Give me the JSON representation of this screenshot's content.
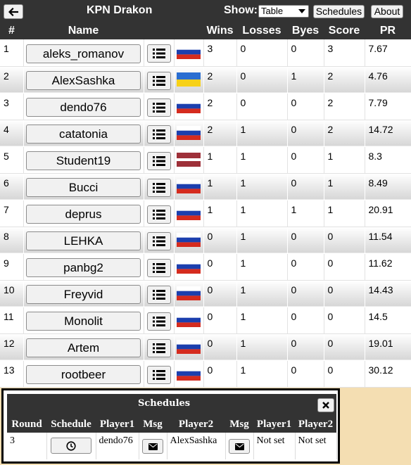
{
  "header": {
    "title": "KPN Drakon",
    "show_label": "Show:",
    "show_selected": "Table",
    "schedules_label": "Schedules",
    "about_label": "About"
  },
  "columns": {
    "rank": "#",
    "name": "Name",
    "wins": "Wins",
    "losses": "Losses",
    "byes": "Byes",
    "score": "Score",
    "pr": "PR"
  },
  "players": [
    {
      "rank": "1",
      "name": "aleks_romanov",
      "flag": "russia",
      "wins": "3",
      "losses": "0",
      "byes": "0",
      "score": "3",
      "pr": "7.67"
    },
    {
      "rank": "2",
      "name": "AlexSashka",
      "flag": "ukraine",
      "wins": "2",
      "losses": "0",
      "byes": "1",
      "score": "2",
      "pr": "4.76"
    },
    {
      "rank": "3",
      "name": "dendo76",
      "flag": "russia",
      "wins": "2",
      "losses": "0",
      "byes": "0",
      "score": "2",
      "pr": "7.79"
    },
    {
      "rank": "4",
      "name": "catatonia",
      "flag": "russia",
      "wins": "2",
      "losses": "1",
      "byes": "0",
      "score": "2",
      "pr": "14.72"
    },
    {
      "rank": "5",
      "name": "Student19",
      "flag": "latvia",
      "wins": "1",
      "losses": "1",
      "byes": "0",
      "score": "1",
      "pr": "8.3"
    },
    {
      "rank": "6",
      "name": "Bucci",
      "flag": "russia",
      "wins": "1",
      "losses": "1",
      "byes": "0",
      "score": "1",
      "pr": "8.49"
    },
    {
      "rank": "7",
      "name": "deprus",
      "flag": "russia",
      "wins": "1",
      "losses": "1",
      "byes": "1",
      "score": "1",
      "pr": "20.91"
    },
    {
      "rank": "8",
      "name": "LEHKA",
      "flag": "russia",
      "wins": "0",
      "losses": "1",
      "byes": "0",
      "score": "0",
      "pr": "11.54"
    },
    {
      "rank": "9",
      "name": "panbg2",
      "flag": "russia",
      "wins": "0",
      "losses": "1",
      "byes": "0",
      "score": "0",
      "pr": "11.62"
    },
    {
      "rank": "10",
      "name": "Freyvid",
      "flag": "russia",
      "wins": "0",
      "losses": "1",
      "byes": "0",
      "score": "0",
      "pr": "14.43"
    },
    {
      "rank": "11",
      "name": "Monolit",
      "flag": "russia",
      "wins": "0",
      "losses": "1",
      "byes": "0",
      "score": "0",
      "pr": "14.5"
    },
    {
      "rank": "12",
      "name": "Artem",
      "flag": "russia",
      "wins": "0",
      "losses": "1",
      "byes": "0",
      "score": "0",
      "pr": "19.01"
    },
    {
      "rank": "13",
      "name": "rootbeer",
      "flag": "russia",
      "wins": "0",
      "losses": "1",
      "byes": "0",
      "score": "0",
      "pr": "30.12"
    }
  ],
  "schedules": {
    "title": "Schedules",
    "columns": [
      "Round",
      "Schedule",
      "Player1",
      "Msg",
      "Player2",
      "Msg",
      "Player1",
      "Player2"
    ],
    "rows": [
      {
        "round": "3",
        "player1": "dendo76",
        "player2": "AlexSashka",
        "p1_status": "Not set",
        "p2_status": "Not set"
      }
    ]
  },
  "icons": {
    "back": "arrow-left-icon",
    "list": "list-icon",
    "close": "close-icon",
    "clock": "clock-icon",
    "mail": "envelope-icon"
  },
  "colors": {
    "header_bg": "#333333",
    "page_bg": "#f4deb2"
  }
}
